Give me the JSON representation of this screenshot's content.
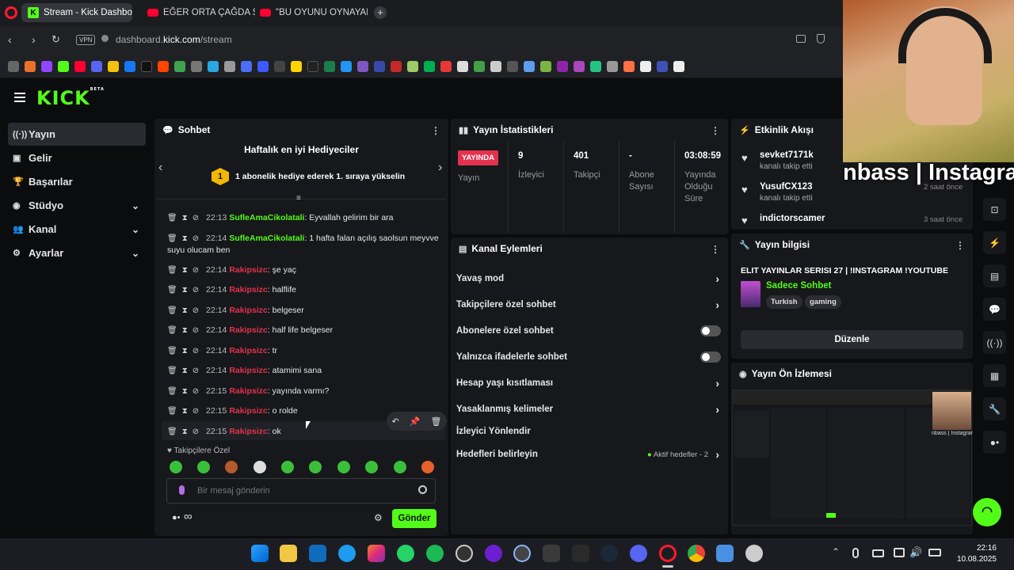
{
  "browser": {
    "tabs": [
      {
        "title": "Stream - Kick Dashboard",
        "active": true
      },
      {
        "title": "EĞER ORTA ÇAĞDA ŞÖVAL",
        "active": false
      },
      {
        "title": "\"BU OYUNU OYNAYAN DE",
        "active": false
      }
    ],
    "vpn_label": "VPN",
    "url_prefix": "dashboard.",
    "url_domain": "kick.com",
    "url_path": "/stream"
  },
  "app": {
    "logo": "KICK",
    "logo_badge": "BETA"
  },
  "sidebar": {
    "items": [
      {
        "label": "Yayın",
        "icon": "broadcast-icon",
        "active": true
      },
      {
        "label": "Gelir",
        "icon": "revenue-icon"
      },
      {
        "label": "Başarılar",
        "icon": "trophy-icon"
      },
      {
        "label": "Stüdyo",
        "icon": "studio-icon",
        "expandable": true
      },
      {
        "label": "Kanal",
        "icon": "channel-icon",
        "expandable": true
      },
      {
        "label": "Ayarlar",
        "icon": "gear-icon",
        "expandable": true
      }
    ]
  },
  "chat": {
    "title": "Sohbet",
    "gifters_title": "Haftalık en iyi Hediyeciler",
    "gifters_rank": "1",
    "gifters_cta": "1 abonelik hediye ederek 1. sıraya yükselin",
    "messages": [
      {
        "time": "22:13",
        "user": "SufleAmaCikolatali",
        "text": ": Eyvallah gelirim bir ara",
        "color": "green"
      },
      {
        "time": "22:14",
        "user": "SufleAmaCikolatali",
        "text": ": 1 hafta falan açılış saolsun meyvve suyu olucam ben",
        "color": "green"
      },
      {
        "time": "22:14",
        "user": "Rakipsizc",
        "text": ": şe yaç",
        "color": "red"
      },
      {
        "time": "22:14",
        "user": "Rakipsizc",
        "text": ": halflife",
        "color": "red"
      },
      {
        "time": "22:14",
        "user": "Rakipsizc",
        "text": ": belgeser",
        "color": "red"
      },
      {
        "time": "22:14",
        "user": "Rakipsizc",
        "text": ": half life belgeser",
        "color": "red"
      },
      {
        "time": "22:14",
        "user": "Rakipsizc",
        "text": ": tr",
        "color": "red"
      },
      {
        "time": "22:14",
        "user": "Rakipsizc",
        "text": ": atamimi sana",
        "color": "red"
      },
      {
        "time": "22:15",
        "user": "Rakipsizc",
        "text": ": yayında varmı?",
        "color": "red"
      },
      {
        "time": "22:15",
        "user": "Rakipsizc",
        "text": ": o rolde",
        "color": "red"
      },
      {
        "time": "22:15",
        "user": "Rakipsizc",
        "text": ": ok",
        "color": "red"
      }
    ],
    "emote_section": "Takipçilere Özel",
    "input_placeholder": "Bir mesaj gönderin",
    "send_label": "Gönder",
    "infinity": "∞"
  },
  "stats": {
    "title": "Yayın İstatistikleri",
    "live_badge": "YAYINDA",
    "live_label": "Yayın",
    "items": [
      {
        "value": "9",
        "label": "İzleyici"
      },
      {
        "value": "401",
        "label": "Takipçi"
      },
      {
        "value": "-",
        "label": "Abone Sayısı"
      },
      {
        "value": "03:08:59",
        "label": "Yayında Olduğu Süre"
      }
    ]
  },
  "channel_actions": {
    "title": "Kanal Eylemleri",
    "items": [
      {
        "label": "Yavaş mod",
        "type": "chevron"
      },
      {
        "label": "Takipçilere özel sohbet",
        "type": "chevron"
      },
      {
        "label": "Abonelere özel sohbet",
        "type": "toggle"
      },
      {
        "label": "Yalnızca ifadelerle sohbet",
        "type": "toggle"
      },
      {
        "label": "Hesap yaşı kısıtlaması",
        "type": "chevron"
      },
      {
        "label": "Yasaklanmış kelimeler",
        "type": "chevron"
      },
      {
        "label": "İzleyici Yönlendir",
        "type": "none"
      },
      {
        "label": "Hedefleri belirleyin",
        "type": "chevron",
        "extra": "Aktif hedefler - 2"
      }
    ]
  },
  "activity": {
    "title": "Etkinlik Akışı",
    "events": [
      {
        "user": "sevket7171k",
        "action": "kanalı takip etti"
      },
      {
        "user": "YusufCX123",
        "action": "kanalı takip etti",
        "time": "2 saat önce"
      },
      {
        "user": "indictorscamer",
        "action": "",
        "time": "3 saat önce"
      }
    ]
  },
  "stream_info": {
    "title": "Yayın bilgisi",
    "stream_title": "ELIT YAYINLAR SERISI 27 | !INSTAGRAM !YOUTUBE",
    "category": "Sadece Sohbet",
    "tags": [
      "Turkish",
      "gaming"
    ],
    "edit_label": "Düzenle"
  },
  "preview": {
    "title": "Yayın Ön İzlemesi",
    "overlay_text": "nbass | Instagran"
  },
  "taskbar": {
    "time": "22:16",
    "date": "10.08.2025"
  },
  "colors": {
    "accent": "#53fc18",
    "live": "#e3324e",
    "panel": "#17181b"
  }
}
